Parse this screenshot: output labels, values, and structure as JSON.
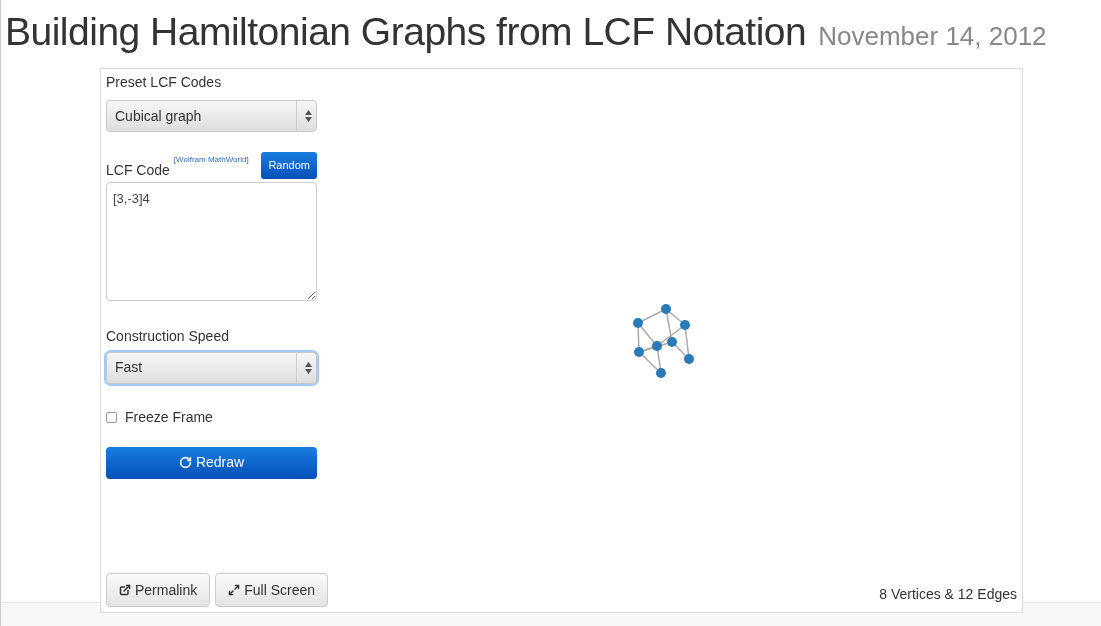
{
  "page": {
    "title": "Building Hamiltonian Graphs from LCF Notation",
    "date": "November 14, 2012"
  },
  "controls": {
    "preset_label": "Preset LCF Codes",
    "preset_value": "Cubical graph",
    "lcf_label": "LCF Code",
    "lcf_link": "[Wolfram MathWorld]",
    "random_button": "Random",
    "lcf_value": "[3,-3]4",
    "speed_label": "Construction Speed",
    "speed_value": "Fast",
    "freeze": {
      "label": "Freeze Frame",
      "checked": false
    },
    "redraw_button": "Redraw",
    "permalink_button": "Permalink",
    "fullscreen_button": "Full Screen"
  },
  "status": "8 Vertices & 12 Edges"
}
